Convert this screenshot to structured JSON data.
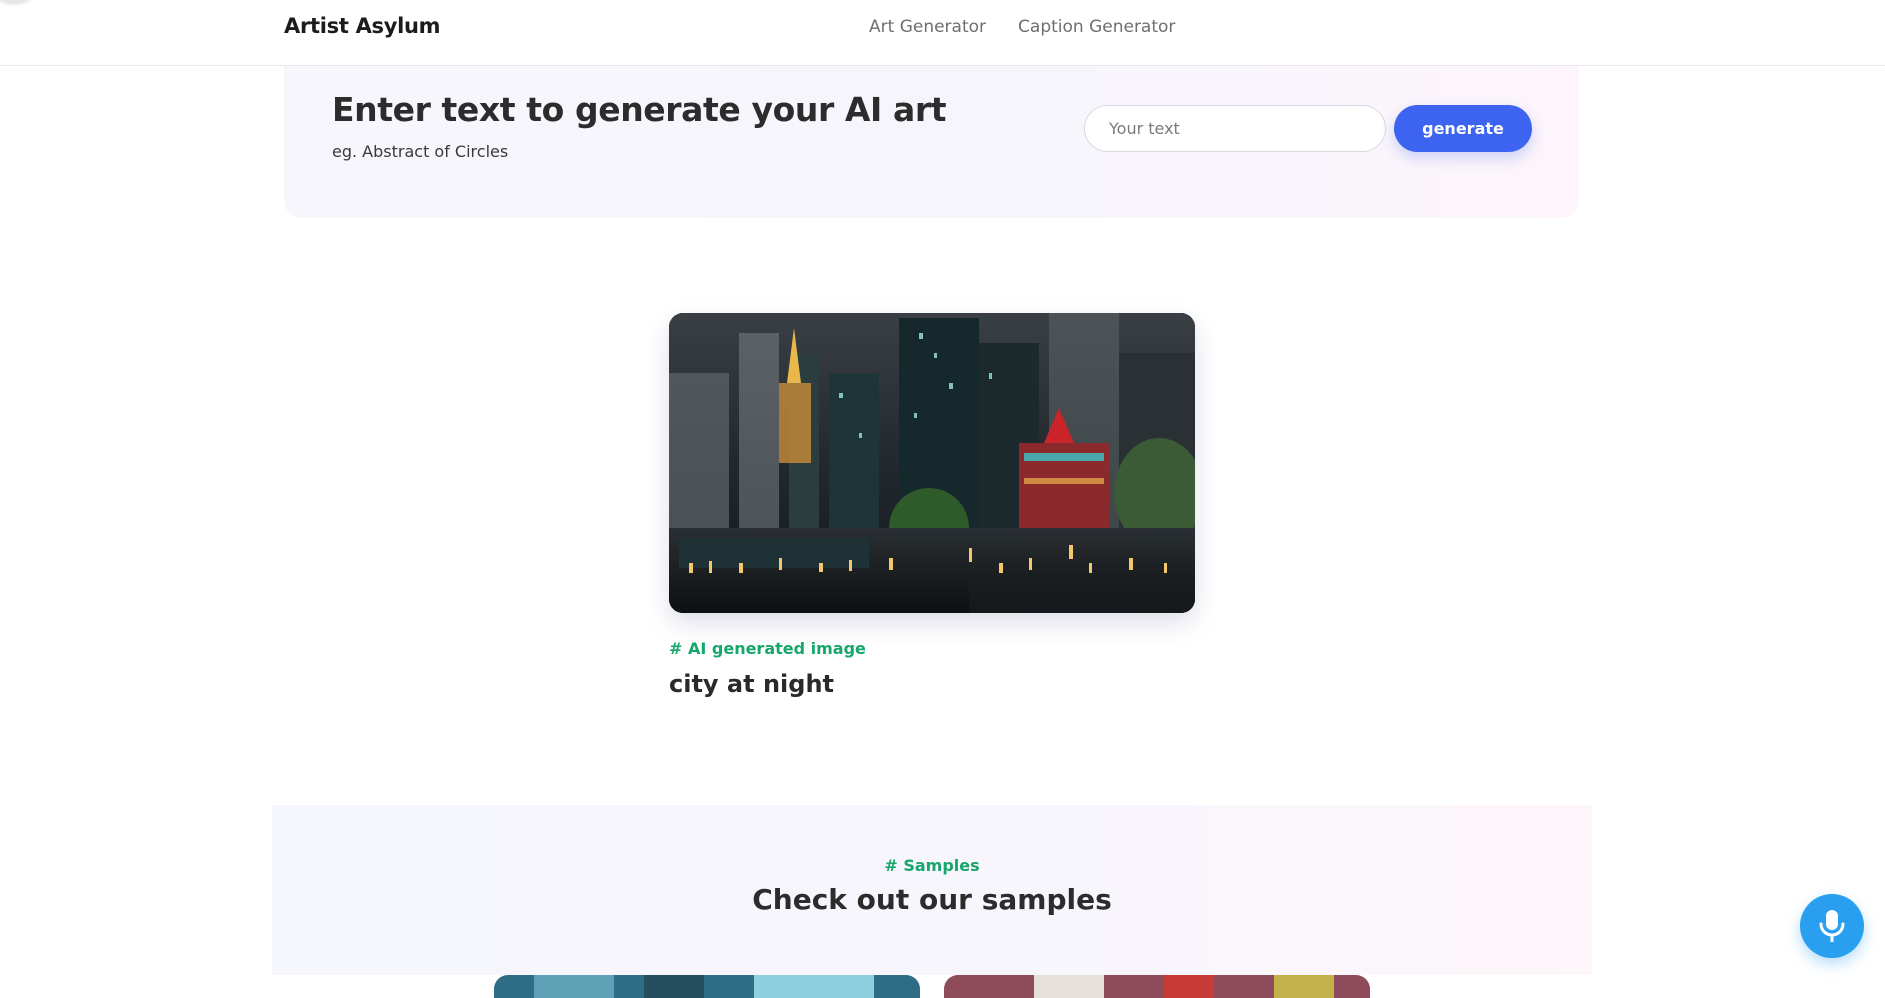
{
  "nav": {
    "brand": "Artist Asylum",
    "links": [
      {
        "label": "Art Generator"
      },
      {
        "label": "Caption Generator"
      }
    ]
  },
  "prompt": {
    "title": "Enter text to generate your AI art",
    "subtitle": "eg. Abstract of Circles",
    "input_value": "",
    "input_placeholder": "Your text",
    "button_label": "generate"
  },
  "result": {
    "tag": "# AI generated image",
    "caption": "city at night"
  },
  "samples": {
    "tag": "# Samples",
    "title": "Check out our samples"
  },
  "icons": {
    "mic": "microphone-icon"
  },
  "colors": {
    "accent": "#3d64f0",
    "tag_green": "#17a66b",
    "mic_blue": "#2a9ff0"
  }
}
